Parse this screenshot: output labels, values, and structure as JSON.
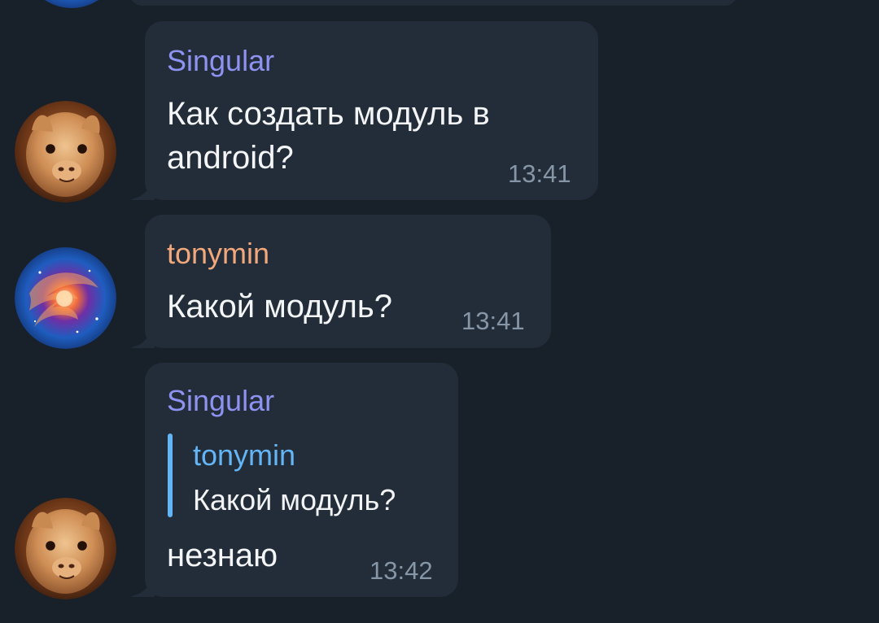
{
  "colors": {
    "background": "#18202a",
    "bubble": "#222d39",
    "singular_name": "#8e92f0",
    "tonymin_name": "#f3a87c",
    "reply_accent": "#64b5f6",
    "time": "#8796a6"
  },
  "messages": [
    {
      "sender": "Singular",
      "text": "Как создать модуль в android?",
      "time": "13:41",
      "avatar": "alpaca-avatar"
    },
    {
      "sender": "tonymin",
      "text": "Какой модуль?",
      "time": "13:41",
      "avatar": "galaxy-avatar"
    },
    {
      "sender": "Singular",
      "reply": {
        "name": "tonymin",
        "text": "Какой модуль?"
      },
      "text": "незнаю",
      "time": "13:42",
      "avatar": "alpaca-avatar"
    }
  ]
}
